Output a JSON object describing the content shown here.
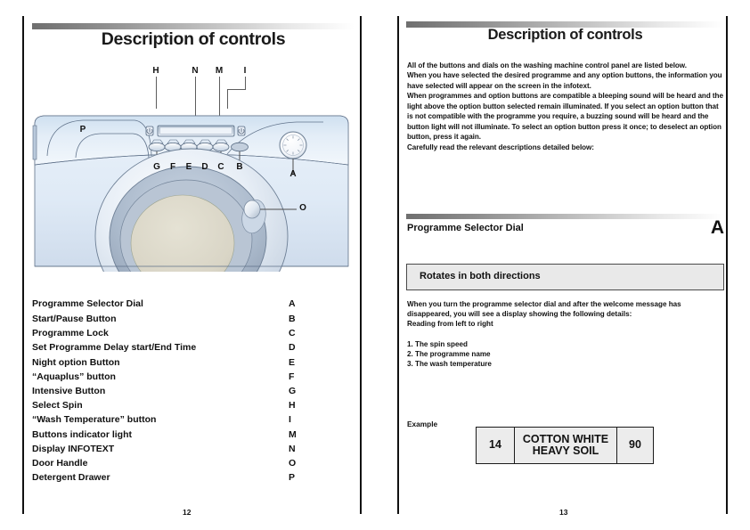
{
  "document": {
    "left_page": {
      "title": "Description of controls",
      "folio": "12",
      "diagram": {
        "top_callouts": [
          {
            "letter": "H"
          },
          {
            "letter": "N"
          },
          {
            "letter": "M"
          },
          {
            "letter": "I"
          }
        ],
        "panel_callouts": [
          {
            "letter": "G"
          },
          {
            "letter": "F"
          },
          {
            "letter": "E"
          },
          {
            "letter": "D"
          },
          {
            "letter": "C"
          },
          {
            "letter": "B"
          }
        ],
        "side_callouts": [
          {
            "letter": "P"
          },
          {
            "letter": "A"
          },
          {
            "letter": "O"
          }
        ]
      },
      "legend": [
        {
          "label": "Programme Selector Dial",
          "code": "A"
        },
        {
          "label": "Start/Pause Button",
          "code": "B"
        },
        {
          "label": "Programme Lock",
          "code": "C"
        },
        {
          "label": "Set Programme Delay start/End Time",
          "code": "D"
        },
        {
          "label": "Night option Button",
          "code": "E"
        },
        {
          "label": "“Aquaplus” button",
          "code": "F"
        },
        {
          "label": "Intensive Button",
          "code": "G"
        },
        {
          "label": "Select Spin",
          "code": "H"
        },
        {
          "label": "“Wash Temperature” button",
          "code": "I"
        },
        {
          "label": "Buttons indicator light",
          "code": "M"
        },
        {
          "label": "Display INFOTEXT",
          "code": "N"
        },
        {
          "label": "Door Handle",
          "code": "O"
        },
        {
          "label": "Detergent Drawer",
          "code": "P"
        }
      ]
    },
    "right_page": {
      "title": "Description of controls",
      "folio": "13",
      "intro": [
        "All of the buttons and dials on the washing machine control panel are listed below.",
        "When you have selected the desired programme and any option buttons, the information you have selected will appear on the screen in the infotext.",
        "When programmes and option buttons are compatible a bleeping sound will be heard and the light above the option button selected remain illuminated. If you select an option button that is not compatible with the programme you require, a buzzing sound will be heard and the button light will not illuminate. To select an option button press it once; to deselect an option button, press it again.",
        "Carefully read the relevant descriptions detailed below:"
      ],
      "section": {
        "title": "Programme Selector Dial",
        "code": "A",
        "note": "Rotates in both directions",
        "body": [
          "When you turn the programme selector dial and after the welcome message has disappeared, you will see a display showing the following details:",
          "Reading from left to right"
        ],
        "numbered_list": [
          "1. The spin speed",
          "2. The programme name",
          "3. The wash temperature"
        ],
        "example_label": "Example",
        "example_table": {
          "spin": "14",
          "programme_line1": "COTTON WHITE",
          "programme_line2": "HEAVY SOIL",
          "temperature": "90"
        }
      }
    }
  },
  "colors": {
    "ink": "#111111",
    "rule_dark": "#6f6f6f",
    "note_fill": "#e9e9e9",
    "machine_body": "#dce8f4"
  }
}
